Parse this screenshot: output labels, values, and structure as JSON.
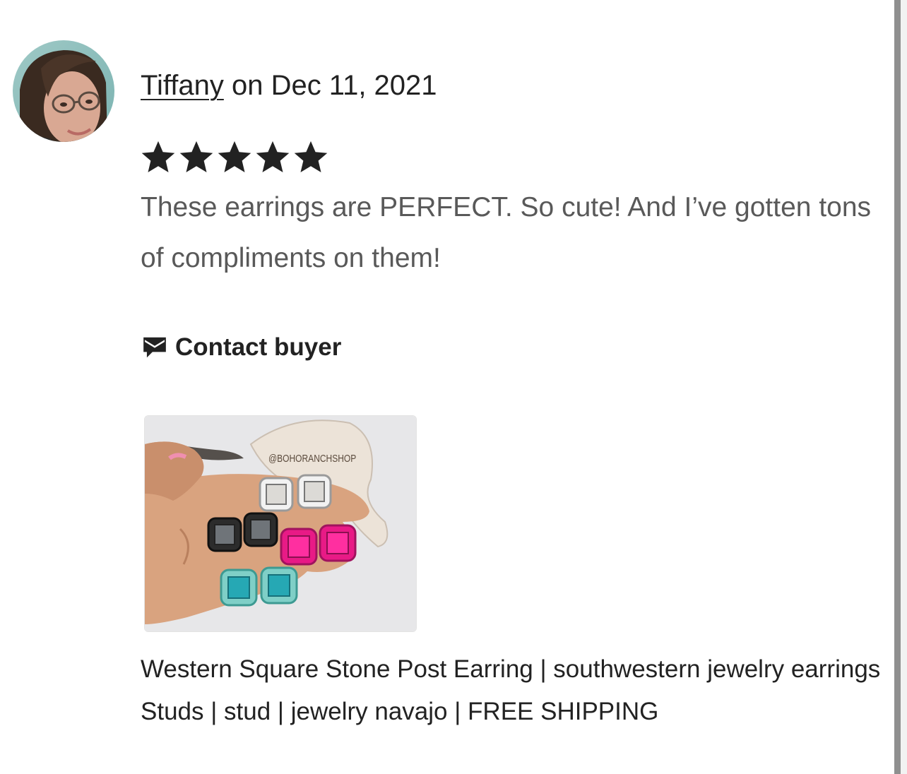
{
  "review": {
    "reviewer_name": "Tiffany",
    "date_text": " on Dec 11, 2021",
    "rating": 5,
    "max_rating": 5,
    "text": "These earrings are PERFECT. So cute! And I’ve gotten tons of compliments on them!"
  },
  "contact": {
    "label": "Contact buyer",
    "icon": "envelope-icon"
  },
  "product": {
    "photo_watermark": "@BOHORANCHSHOP",
    "title": "Western Square Stone Post Earring | southwestern jewelry earrings Studs | stud | jewelry navajo | FREE SHIPPING"
  },
  "colors": {
    "text_primary": "#222222",
    "text_secondary": "#595959",
    "star": "#222222"
  }
}
